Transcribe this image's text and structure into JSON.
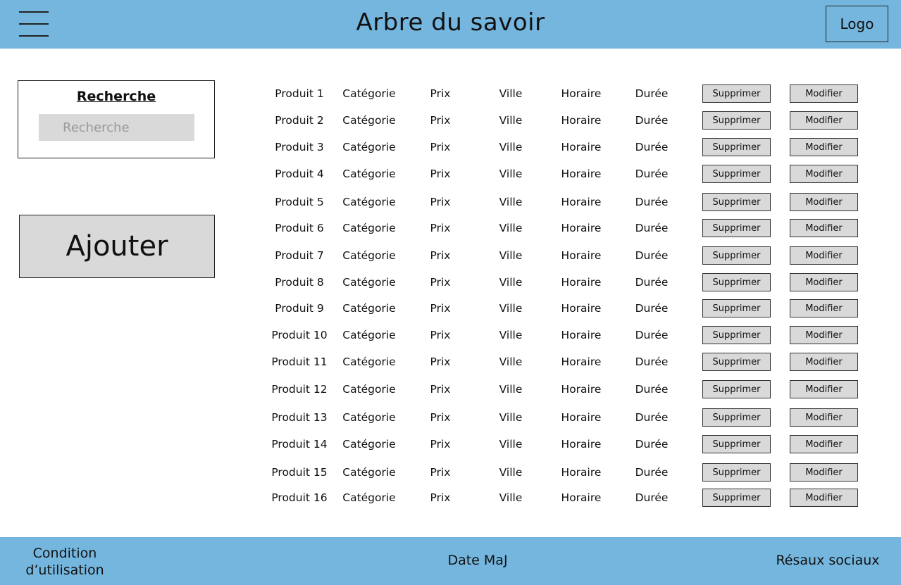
{
  "header": {
    "title": "Arbre du savoir",
    "logo_label": "Logo",
    "menu_icon": "hamburger-menu-icon"
  },
  "search": {
    "title": "Recherche",
    "placeholder": "Recherche",
    "value": ""
  },
  "add_button_label": "Ajouter",
  "products": [
    {
      "name": "Produit 1",
      "category": "Catégorie",
      "price": "Prix",
      "city": "Ville",
      "schedule": "Horaire",
      "duration": "Durée",
      "delete_label": "Supprimer",
      "edit_label": "Modifier"
    },
    {
      "name": "Produit 2",
      "category": "Catégorie",
      "price": "Prix",
      "city": "Ville",
      "schedule": "Horaire",
      "duration": "Durée",
      "delete_label": "Supprimer",
      "edit_label": "Modifier"
    },
    {
      "name": "Produit 3",
      "category": "Catégorie",
      "price": "Prix",
      "city": "Ville",
      "schedule": "Horaire",
      "duration": "Durée",
      "delete_label": "Supprimer",
      "edit_label": "Modifier"
    },
    {
      "name": "Produit 4",
      "category": "Catégorie",
      "price": "Prix",
      "city": "Ville",
      "schedule": "Horaire",
      "duration": "Durée",
      "delete_label": "Supprimer",
      "edit_label": "Modifier"
    },
    {
      "name": "Produit 5",
      "category": "Catégorie",
      "price": "Prix",
      "city": "Ville",
      "schedule": "Horaire",
      "duration": "Durée",
      "delete_label": "Supprimer",
      "edit_label": "Modifier"
    },
    {
      "name": "Produit 6",
      "category": "Catégorie",
      "price": "Prix",
      "city": "Ville",
      "schedule": "Horaire",
      "duration": "Durée",
      "delete_label": "Supprimer",
      "edit_label": "Modifier"
    },
    {
      "name": "Produit 7",
      "category": "Catégorie",
      "price": "Prix",
      "city": "Ville",
      "schedule": "Horaire",
      "duration": "Durée",
      "delete_label": "Supprimer",
      "edit_label": "Modifier"
    },
    {
      "name": "Produit 8",
      "category": "Catégorie",
      "price": "Prix",
      "city": "Ville",
      "schedule": "Horaire",
      "duration": "Durée",
      "delete_label": "Supprimer",
      "edit_label": "Modifier"
    },
    {
      "name": "Produit 9",
      "category": "Catégorie",
      "price": "Prix",
      "city": "Ville",
      "schedule": "Horaire",
      "duration": "Durée",
      "delete_label": "Supprimer",
      "edit_label": "Modifier"
    },
    {
      "name": "Produit 10",
      "category": "Catégorie",
      "price": "Prix",
      "city": "Ville",
      "schedule": "Horaire",
      "duration": "Durée",
      "delete_label": "Supprimer",
      "edit_label": "Modifier"
    },
    {
      "name": "Produit 11",
      "category": "Catégorie",
      "price": "Prix",
      "city": "Ville",
      "schedule": "Horaire",
      "duration": "Durée",
      "delete_label": "Supprimer",
      "edit_label": "Modifier"
    },
    {
      "name": "Produit 12",
      "category": "Catégorie",
      "price": "Prix",
      "city": "Ville",
      "schedule": "Horaire",
      "duration": "Durée",
      "delete_label": "Supprimer",
      "edit_label": "Modifier"
    },
    {
      "name": "Produit 13",
      "category": "Catégorie",
      "price": "Prix",
      "city": "Ville",
      "schedule": "Horaire",
      "duration": "Durée",
      "delete_label": "Supprimer",
      "edit_label": "Modifier"
    },
    {
      "name": "Produit 14",
      "category": "Catégorie",
      "price": "Prix",
      "city": "Ville",
      "schedule": "Horaire",
      "duration": "Durée",
      "delete_label": "Supprimer",
      "edit_label": "Modifier"
    },
    {
      "name": "Produit 15",
      "category": "Catégorie",
      "price": "Prix",
      "city": "Ville",
      "schedule": "Horaire",
      "duration": "Durée",
      "delete_label": "Supprimer",
      "edit_label": "Modifier"
    },
    {
      "name": "Produit 16",
      "category": "Catégorie",
      "price": "Prix",
      "city": "Ville",
      "schedule": "Horaire",
      "duration": "Durée",
      "delete_label": "Supprimer",
      "edit_label": "Modifier"
    }
  ],
  "footer": {
    "terms_label": "Condition d’utilisation",
    "update_date_label": "Date MaJ",
    "social_label": "Résaux sociaux"
  },
  "colors": {
    "header_bg": "#75b6df",
    "footer_bg": "#75b6df",
    "button_bg": "#d9d9d9"
  }
}
